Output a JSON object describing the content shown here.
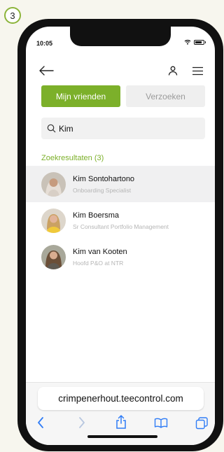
{
  "step_number": "3",
  "status_bar": {
    "time": "10:05"
  },
  "segments": {
    "friends": "Mijn vrienden",
    "requests": "Verzoeken"
  },
  "search": {
    "value": "Kim"
  },
  "results": {
    "title": "Zoekresultaten (3)",
    "items": [
      {
        "name": "Kim Sontohartono",
        "role": "Onboarding Specialist"
      },
      {
        "name": "Kim Boersma",
        "role": "Sr Consultant Portfolio Management"
      },
      {
        "name": "Kim van Kooten",
        "role": "Hoofd P&O at NTR"
      }
    ]
  },
  "browser": {
    "url": "crimpenerhout.teecontrol.com"
  },
  "colors": {
    "accent": "#7cb02a",
    "selected_row": "#f0f0f1"
  },
  "icons": [
    "back-arrow-icon",
    "person-icon",
    "menu-icon",
    "search-icon",
    "chevron-left-icon",
    "chevron-right-icon",
    "share-icon",
    "bookmarks-icon",
    "tabs-icon"
  ]
}
